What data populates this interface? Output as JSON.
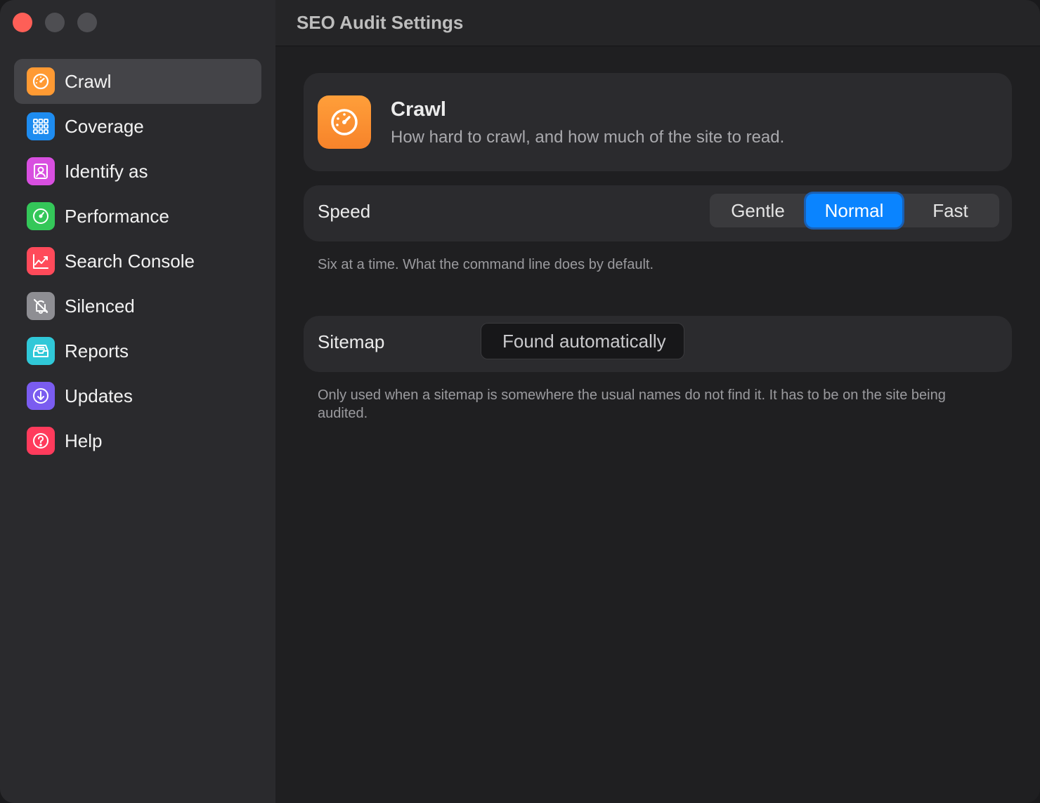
{
  "window": {
    "title": "SEO Audit Settings"
  },
  "sidebar": {
    "items": [
      {
        "label": "Crawl",
        "icon": "speedometer-icon",
        "color": "#ff9a33",
        "active": true
      },
      {
        "label": "Coverage",
        "icon": "grid-icon",
        "color": "#1e8cf0",
        "active": false
      },
      {
        "label": "Identify as",
        "icon": "person-icon",
        "color": "#d84fe0",
        "active": false
      },
      {
        "label": "Performance",
        "icon": "gauge-icon",
        "color": "#34c759",
        "active": false
      },
      {
        "label": "Search Console",
        "icon": "chart-icon",
        "color": "#ff4a5a",
        "active": false
      },
      {
        "label": "Silenced",
        "icon": "bell-slash-icon",
        "color": "#8e8e93",
        "active": false
      },
      {
        "label": "Reports",
        "icon": "tray-icon",
        "color": "#30c8d8",
        "active": false
      },
      {
        "label": "Updates",
        "icon": "arrow-down-circle-icon",
        "color": "#7a5cf0",
        "active": false
      },
      {
        "label": "Help",
        "icon": "question-icon",
        "color": "#ff3b5c",
        "active": false
      }
    ]
  },
  "header": {
    "title": "Crawl",
    "subtitle": "How hard to crawl, and how much of the site to read."
  },
  "speed": {
    "label": "Speed",
    "options": [
      "Gentle",
      "Normal",
      "Fast"
    ],
    "selected": "Normal",
    "note": "Six at a time. What the command line does by default."
  },
  "sitemap": {
    "label": "Sitemap",
    "placeholder": "Found automatically",
    "note": "Only used when a sitemap is somewhere the usual names do not find it. It has to be on the site being audited."
  },
  "colors": {
    "accent": "#0a84ff",
    "close": "#fe5f57"
  }
}
